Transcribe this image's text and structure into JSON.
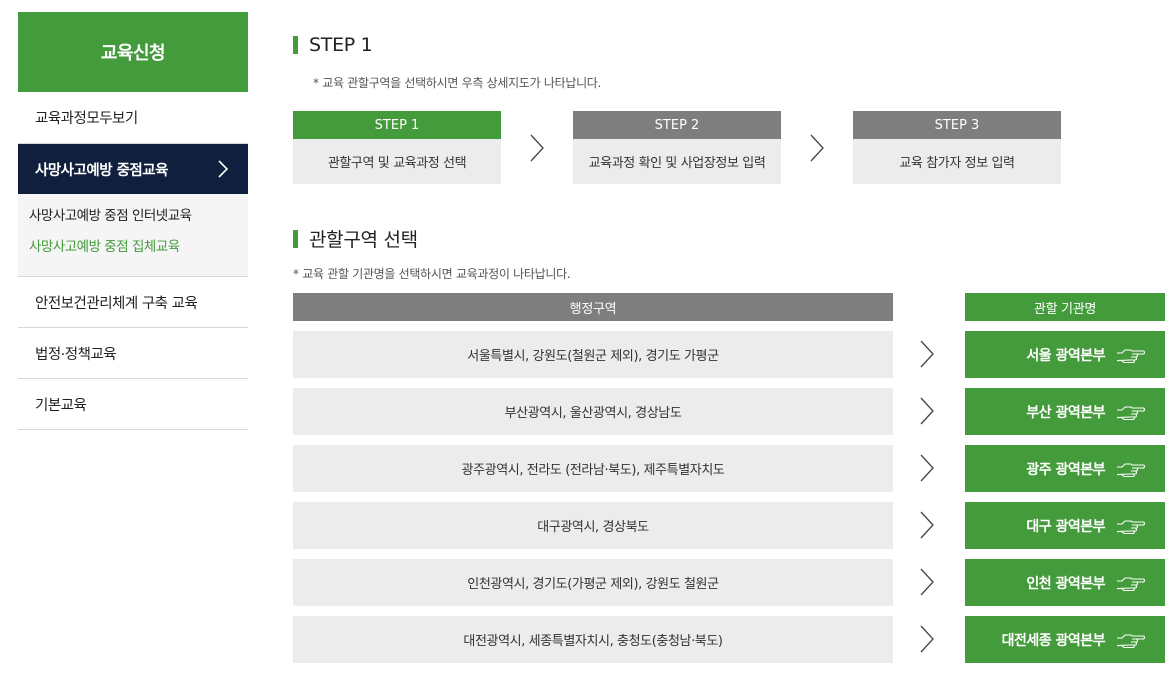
{
  "sidebar": {
    "title": "교육신청",
    "items": [
      {
        "label": "교육과정모두보기"
      },
      {
        "label": "사망사고예방 중점교육"
      },
      {
        "label": "안전보건관리체계 구축 교육"
      },
      {
        "label": "법정·정책교육"
      },
      {
        "label": "기본교육"
      }
    ],
    "subitems": [
      {
        "label": "사망사고예방 중점 인터넷교육"
      },
      {
        "label": "사망사고예방 중점 집체교육"
      }
    ]
  },
  "step_section": {
    "title": "STEP 1",
    "note": "* 교육 관할구역을 선택하시면 우측 상세지도가 나타납니다.",
    "steps": [
      {
        "head": "STEP 1",
        "body": "관할구역 및 교육과정 선택"
      },
      {
        "head": "STEP 2",
        "body": "교육과정 확인 및 사업장정보 입력"
      },
      {
        "head": "STEP 3",
        "body": "교육 참가자 정보 입력"
      }
    ]
  },
  "region_section": {
    "title": "관할구역 선택",
    "note": "* 교육 관할 기관명을 선택하시면 교육과정이 나타납니다.",
    "col_region": "행정구역",
    "col_office": "관할 기관명",
    "rows": [
      {
        "region": "서울특별시, 강원도(철원군 제외), 경기도 가평군",
        "office": "서울 광역본부"
      },
      {
        "region": "부산광역시, 울산광역시, 경상남도",
        "office": "부산 광역본부"
      },
      {
        "region": "광주광역시, 전라도 (전라남·북도), 제주특별자치도",
        "office": "광주 광역본부"
      },
      {
        "region": "대구광역시, 경상북도",
        "office": "대구 광역본부"
      },
      {
        "region": "인천광역시, 경기도(가평군 제외), 강원도 철원군",
        "office": "인천 광역본부"
      },
      {
        "region": "대전광역시, 세종특별자치시, 충청도(충청남·북도)",
        "office": "대전세종 광역본부"
      }
    ]
  },
  "colors": {
    "accent": "#439b3b",
    "nav_active": "#0f1f3d",
    "header_gray": "#7e7e7e"
  },
  "icons": {
    "row_arrow": "chevron-right-icon",
    "office_icon": "pointing-hand-icon"
  }
}
